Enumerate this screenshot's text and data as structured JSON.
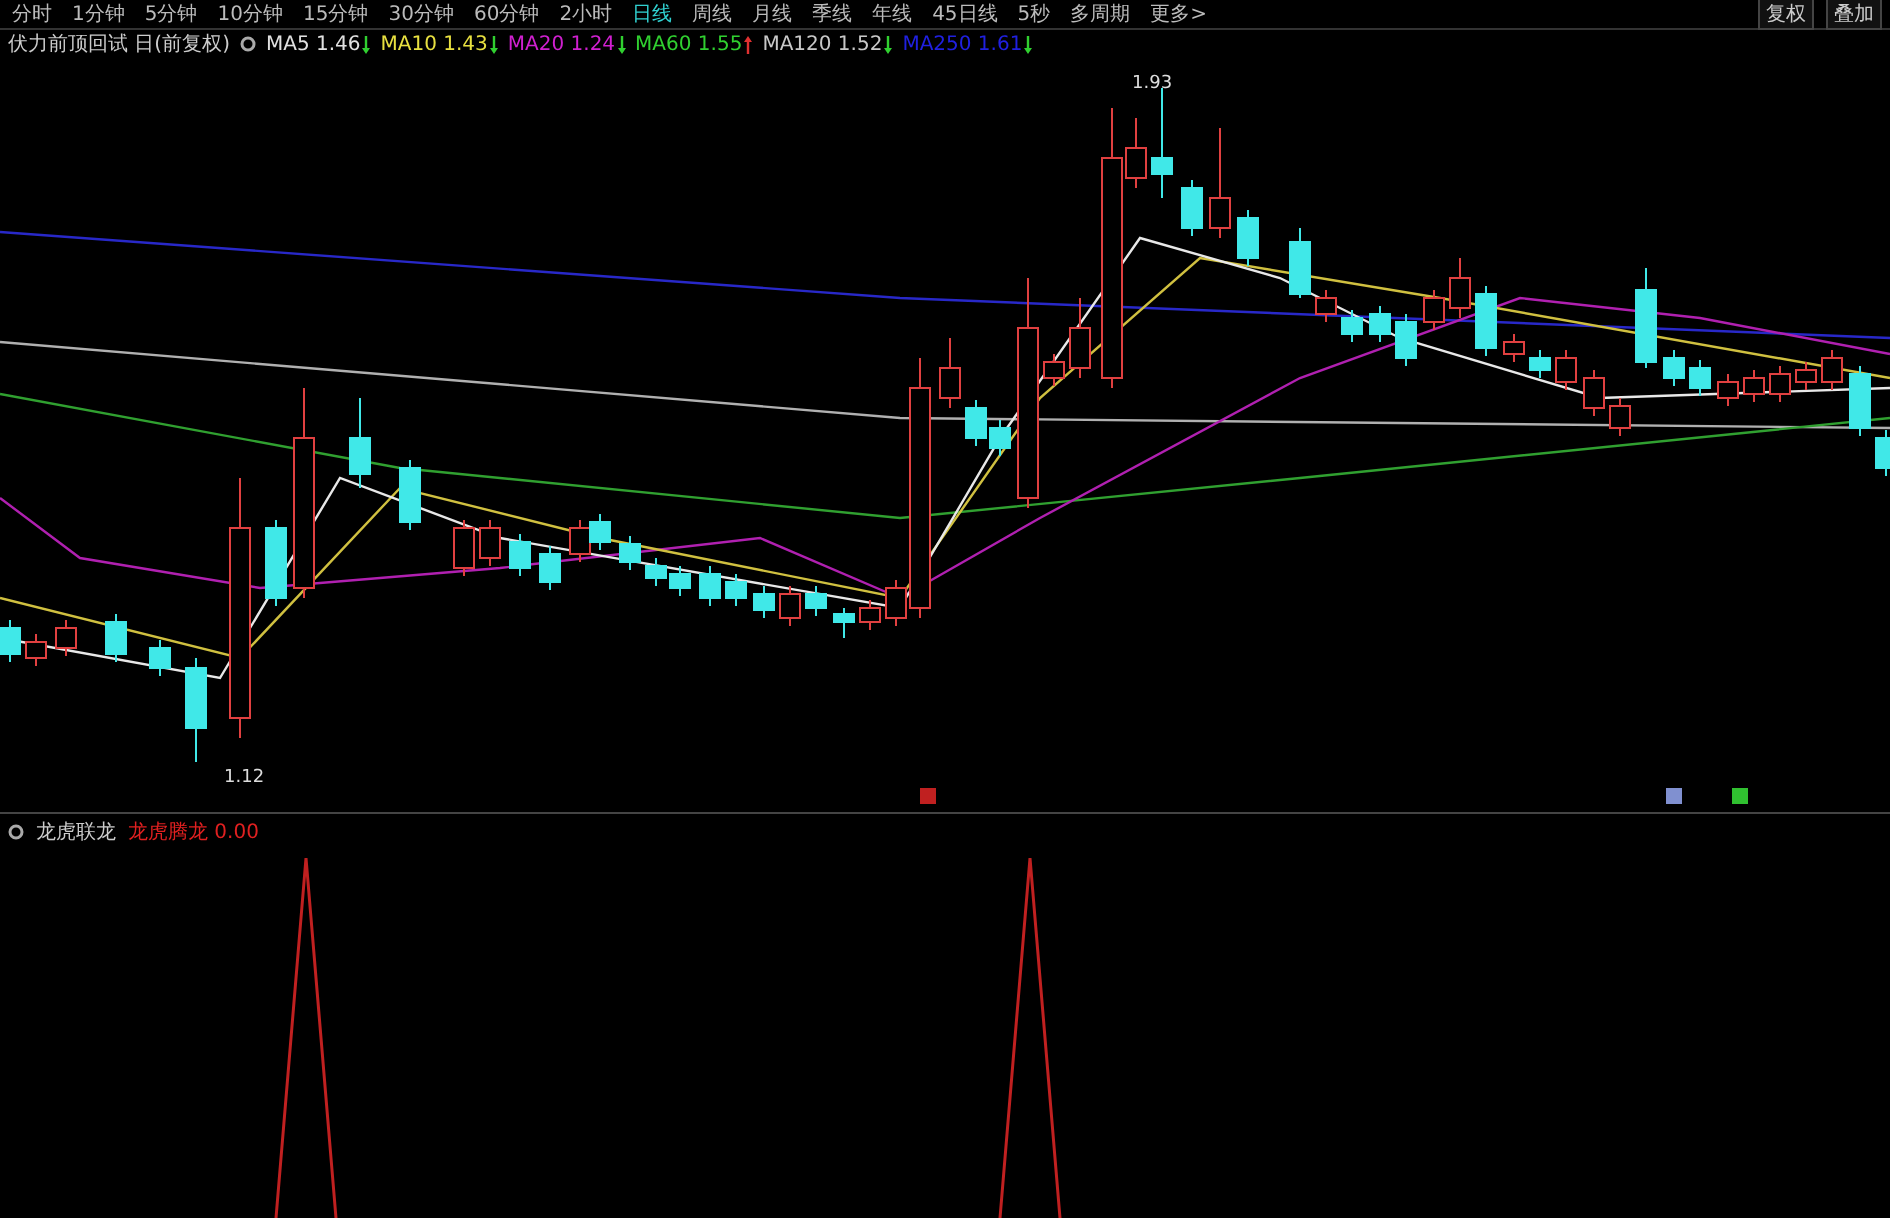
{
  "toolbar": {
    "periods": [
      {
        "label": "分时",
        "selected": false
      },
      {
        "label": "1分钟",
        "selected": false
      },
      {
        "label": "5分钟",
        "selected": false
      },
      {
        "label": "10分钟",
        "selected": false
      },
      {
        "label": "15分钟",
        "selected": false
      },
      {
        "label": "30分钟",
        "selected": false
      },
      {
        "label": "60分钟",
        "selected": false
      },
      {
        "label": "2小时",
        "selected": false
      },
      {
        "label": "日线",
        "selected": true
      },
      {
        "label": "周线",
        "selected": false
      },
      {
        "label": "月线",
        "selected": false
      },
      {
        "label": "季线",
        "selected": false
      },
      {
        "label": "年线",
        "selected": false
      },
      {
        "label": "45日线",
        "selected": false
      },
      {
        "label": "5秒",
        "selected": false
      },
      {
        "label": "多周期",
        "selected": false
      },
      {
        "label": "更多>",
        "selected": false
      }
    ],
    "right_buttons": [
      "复权",
      "叠加"
    ]
  },
  "legend": {
    "title": "伏力前顶回试 日(前复权)",
    "indicators": [
      {
        "label": "MA5 1.46",
        "color": "#e0e0e0",
        "kind": "down"
      },
      {
        "label": "MA10 1.43",
        "color": "#e8e040",
        "kind": "down"
      },
      {
        "label": "MA20 1.24",
        "color": "#d020d0",
        "kind": "down"
      },
      {
        "label": "MA60 1.55",
        "color": "#30d030",
        "kind": "up"
      },
      {
        "label": "MA120 1.52",
        "color": "#c8c8c8",
        "kind": "down"
      },
      {
        "label": "MA250 1.61",
        "color": "#2020e0",
        "kind": "down"
      }
    ]
  },
  "price_labels": {
    "high": "1.93",
    "low": "1.12"
  },
  "signals": [
    {
      "color": "#c02020"
    },
    {
      "color": "#8090d0"
    },
    {
      "color": "#30c030"
    }
  ],
  "sub_panel": {
    "name": "龙虎联龙",
    "reading": "龙虎腾龙 0.00"
  }
}
